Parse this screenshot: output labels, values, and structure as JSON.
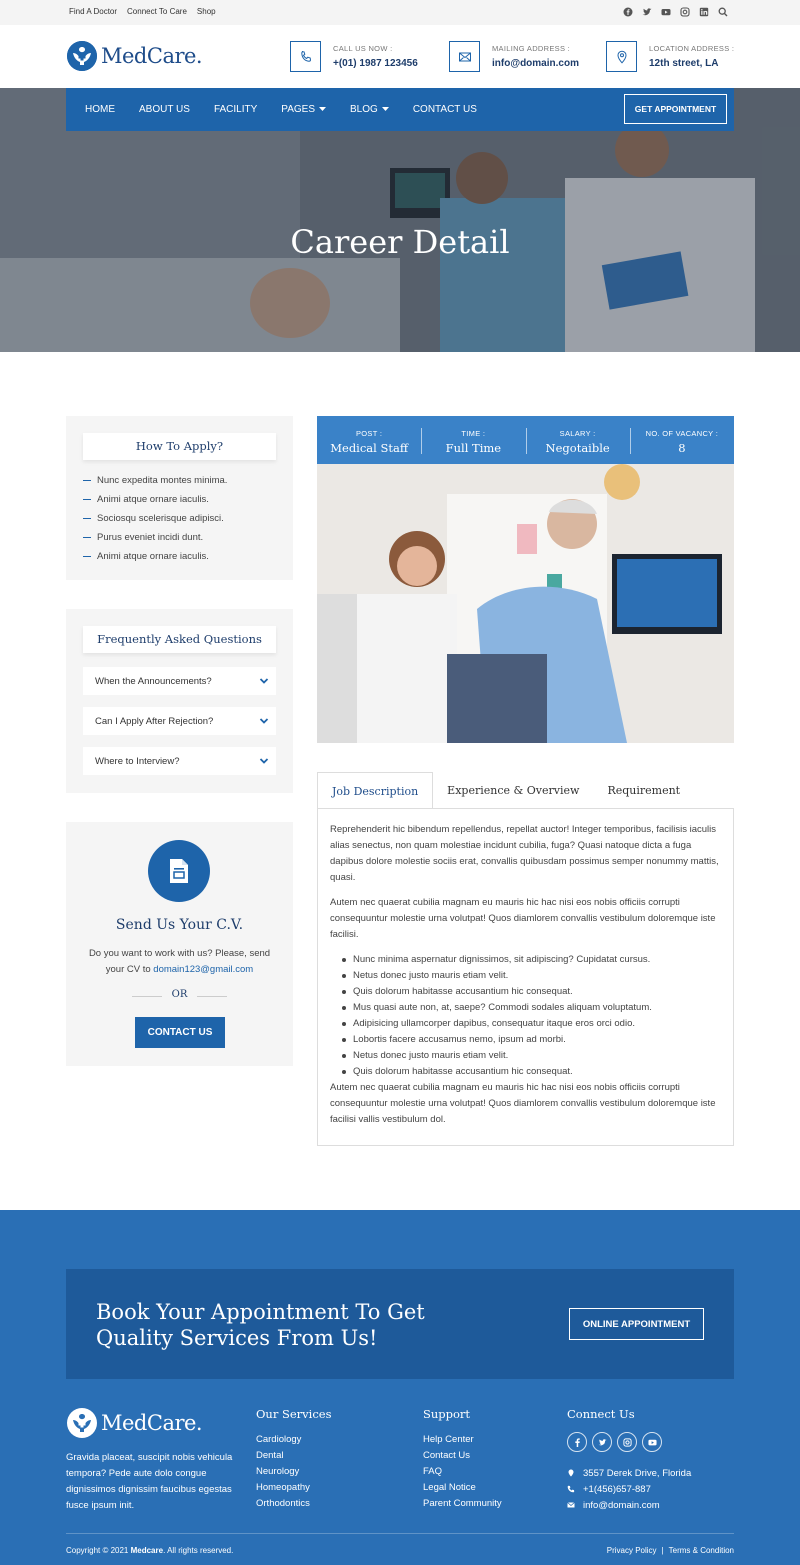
{
  "topbar": {
    "links": [
      "Find A Doctor",
      "Connect To Care",
      "Shop"
    ],
    "icons": [
      "facebook-icon",
      "twitter-icon",
      "youtube-icon",
      "instagram-icon",
      "linkedin-icon",
      "search-icon"
    ]
  },
  "header": {
    "logo_text": "MedCare.",
    "call_label": "CALL US NOW :",
    "call_value": "+(01) 1987 123456",
    "mail_label": "MAILING ADDRESS :",
    "mail_value": "info@domain.com",
    "location_label": "LOCATION ADDRESS :",
    "location_value": "12th street, LA"
  },
  "nav": {
    "items": [
      "HOME",
      "ABOUT US",
      "FACILITY",
      "PAGES",
      "BLOG",
      "CONTACT US"
    ],
    "button": "GET APPOINTMENT"
  },
  "hero": {
    "title": "Career Detail"
  },
  "sidebar": {
    "apply_title": "How To Apply?",
    "apply_items": [
      "Nunc expedita montes minima.",
      "Animi atque ornare iaculis.",
      "Sociosqu scelerisque adipisci.",
      "Purus eveniet incidi dunt.",
      "Animi atque ornare iaculis."
    ],
    "faq_title": "Frequently Asked Questions",
    "faq_items": [
      "When the Announcements?",
      "Can I Apply After Rejection?",
      "Where to Interview?"
    ],
    "cv_title": "Send Us Your C.V.",
    "cv_text_1": "Do you want to work with us? Please, send",
    "cv_text_2": "your CV to",
    "cv_email": "domain123@gmail.com",
    "cv_or": "OR",
    "cv_button": "CONTACT US"
  },
  "job": {
    "post_label": "POST :",
    "post_value": "Medical Staff",
    "time_label": "TIME :",
    "time_value": "Full Time",
    "salary_label": "SALARY :",
    "salary_value": "Negotaible",
    "vacancy_label": "NO. OF VACANCY :",
    "vacancy_value": "8"
  },
  "tabs": {
    "items": [
      "Job Description",
      "Experience & Overview",
      "Requirement"
    ],
    "para1": "Reprehenderit hic bibendum repellendus, repellat auctor! Integer temporibus, facilisis iaculis alias senectus, non quam molestiae incidunt cubilia, fuga? Quasi natoque dicta a fuga dapibus dolore molestie sociis erat, convallis quibusdam possimus semper nonummy mattis, quasi.",
    "para2": "Autem nec quaerat cubilia magnam eu mauris hic hac nisi eos nobis officiis corrupti consequuntur molestie urna volutpat! Quos diamlorem convallis vestibulum doloremque iste facilisi.",
    "bullets": [
      "Nunc minima aspernatur dignissimos, sit adipiscing? Cupidatat cursus.",
      "Netus donec justo mauris etiam velit.",
      "Quis dolorum habitasse accusantium hic consequat.",
      "Mus quasi aute non, at, saepe? Commodi sodales aliquam voluptatum.",
      "Adipisicing ullamcorper dapibus, consequatur itaque eros orci odio.",
      "Lobortis facere accusamus nemo, ipsum ad morbi.",
      "Netus donec justo mauris etiam velit.",
      "Quis dolorum habitasse accusantium hic consequat."
    ],
    "para3": "Autem nec quaerat cubilia magnam eu mauris hic hac nisi eos nobis officiis corrupti consequuntur molestie urna volutpat! Quos diamlorem convallis vestibulum doloremque iste facilisi vallis vestibulum dol."
  },
  "cta": {
    "text": "Book Your Appointment To Get Quality Services From Us!",
    "button": "ONLINE APPOINTMENT"
  },
  "footer": {
    "logo_text": "MedCare.",
    "about": "Gravida placeat, suscipit nobis vehicula tempora? Pede aute dolo congue dignissimos dignissim faucibus egestas fusce ipsum init.",
    "services_title": "Our Services",
    "services": [
      "Cardiology",
      "Dental",
      "Neurology",
      "Homeopathy",
      "Orthodontics"
    ],
    "support_title": "Support",
    "support": [
      "Help Center",
      "Contact Us",
      "FAQ",
      "Legal Notice",
      "Parent Community"
    ],
    "contact_title": "Connect Us",
    "address": "3557 Derek Drive, Florida",
    "phone": "+1(456)657-887",
    "email": "info@domain.com",
    "copyright_pre": "Copyright © 2021",
    "copyright_brand": "Medcare",
    "copyright_post": ". All rights reserved.",
    "privacy": "Privacy Policy",
    "sep": "|",
    "terms": "Terms & Condition"
  },
  "colors": {
    "primary": "#1e64aa",
    "nav": "#1e64aa",
    "footer": "#2a6fb5"
  }
}
